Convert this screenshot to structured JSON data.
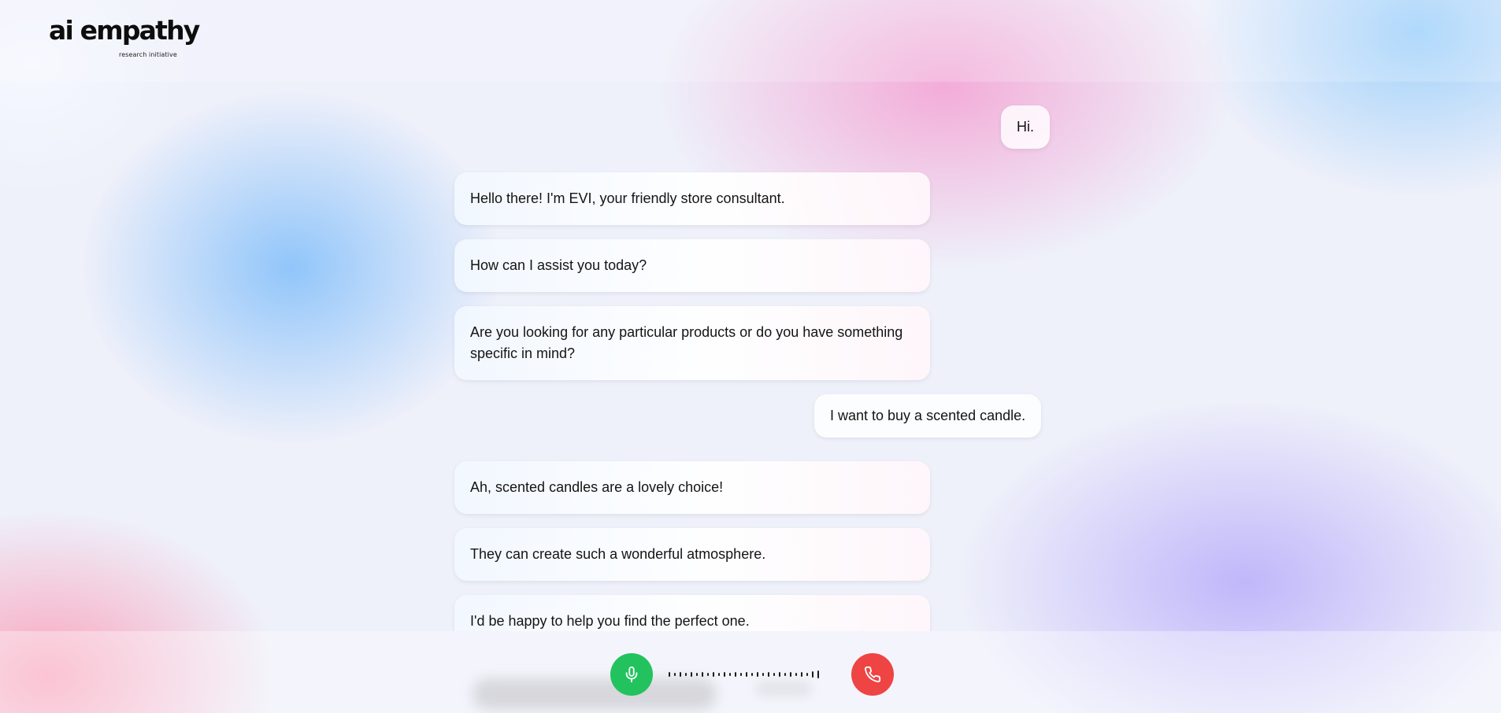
{
  "header": {
    "logo_text": "ai empathy",
    "logo_subtitle": "research initiative"
  },
  "conversation": [
    {
      "role": "user",
      "text": "Hi."
    },
    {
      "role": "assistant",
      "text": "Hello there! I'm EVI, your friendly store consultant."
    },
    {
      "role": "assistant",
      "text": "How can I assist you today?"
    },
    {
      "role": "assistant",
      "text": "Are you looking for any particular products or do you have something specific in mind?"
    },
    {
      "role": "user",
      "text": "I want to buy a scented candle."
    },
    {
      "role": "assistant",
      "text": "Ah, scented candles are a lovely choice!"
    },
    {
      "role": "assistant",
      "text": "They can create such a wonderful atmosphere."
    },
    {
      "role": "assistant",
      "text": "I'd be happy to help you find the perfect one."
    }
  ],
  "controls": {
    "mic_icon": "microphone-icon",
    "end_call_icon": "phone-hangup-icon",
    "mic_button_color": "#22c35e",
    "end_button_color": "#ef4444"
  },
  "colors": {
    "blue_glow": "#8cc3fa",
    "pink_glow": "#f4a0d2",
    "violet_glow": "#beb4fa",
    "rose_glow": "#faa0b9"
  }
}
